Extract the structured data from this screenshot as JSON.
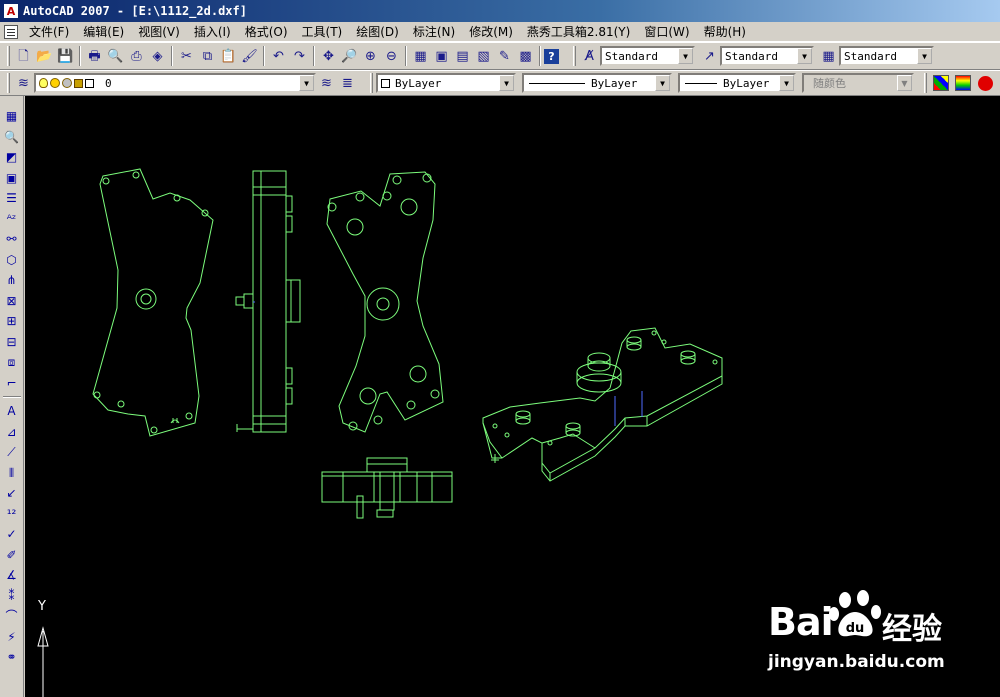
{
  "window": {
    "title": "AutoCAD 2007 - [E:\\1112_2d.dxf]"
  },
  "menu": [
    "文件(F)",
    "编辑(E)",
    "视图(V)",
    "插入(I)",
    "格式(O)",
    "工具(T)",
    "绘图(D)",
    "标注(N)",
    "修改(M)",
    "燕秀工具箱2.81(Y)",
    "窗口(W)",
    "帮助(H)"
  ],
  "standard_toolbar": {
    "icons": [
      "new-icon",
      "open-icon",
      "save-icon",
      "plot-icon",
      "plot-preview-icon",
      "publish-icon",
      "3d-dwf-icon",
      "cut-icon",
      "copy-icon",
      "paste-icon",
      "match-properties-icon",
      "undo-icon",
      "redo-icon",
      "pan-icon",
      "zoom-realtime-icon",
      "zoom-window-icon",
      "zoom-previous-icon",
      "properties-icon",
      "design-center-icon",
      "tool-palettes-icon",
      "sheet-set-icon",
      "markup-icon",
      "calculator-icon",
      "help-icon"
    ],
    "text_style": "Standard",
    "dim_style": "Standard",
    "table_style": "Standard"
  },
  "layers_toolbar": {
    "layer_name": "0",
    "color": "ByLayer",
    "linetype": "ByLayer",
    "lineweight": "ByLayer",
    "plot_style": "随颜色"
  },
  "left_toolbar": [
    "table-icon",
    "zoom-icon",
    "shapes-icon",
    "block-icon",
    "list-icon",
    "text-icon",
    "link-icon",
    "3d-box-icon",
    "split-icon",
    "hatch-icon",
    "grid-icon",
    "array-icon",
    "mirror-icon",
    "fillet-icon",
    "text-a-icon",
    "dim-linear-icon",
    "dim-aligned-icon",
    "dim-baseline-icon",
    "dim-radius-icon",
    "dim-number-icon",
    "dim-check-icon",
    "dim-edit-icon",
    "dim-angle-icon",
    "dim-ordinate-icon",
    "dim-arc-icon",
    "dim-jog-icon",
    "dim-leader-icon"
  ],
  "ucs": {
    "y_label": "Y"
  },
  "watermark": {
    "brand_left": "Bai",
    "brand_right": "经验",
    "url": "jingyan.baidu.com"
  },
  "colors": {
    "drawing_line": "#7CFC7C",
    "hidden_blue": "#4f6cff",
    "canvas": "#000000",
    "ui_face": "#d4d0c8"
  }
}
